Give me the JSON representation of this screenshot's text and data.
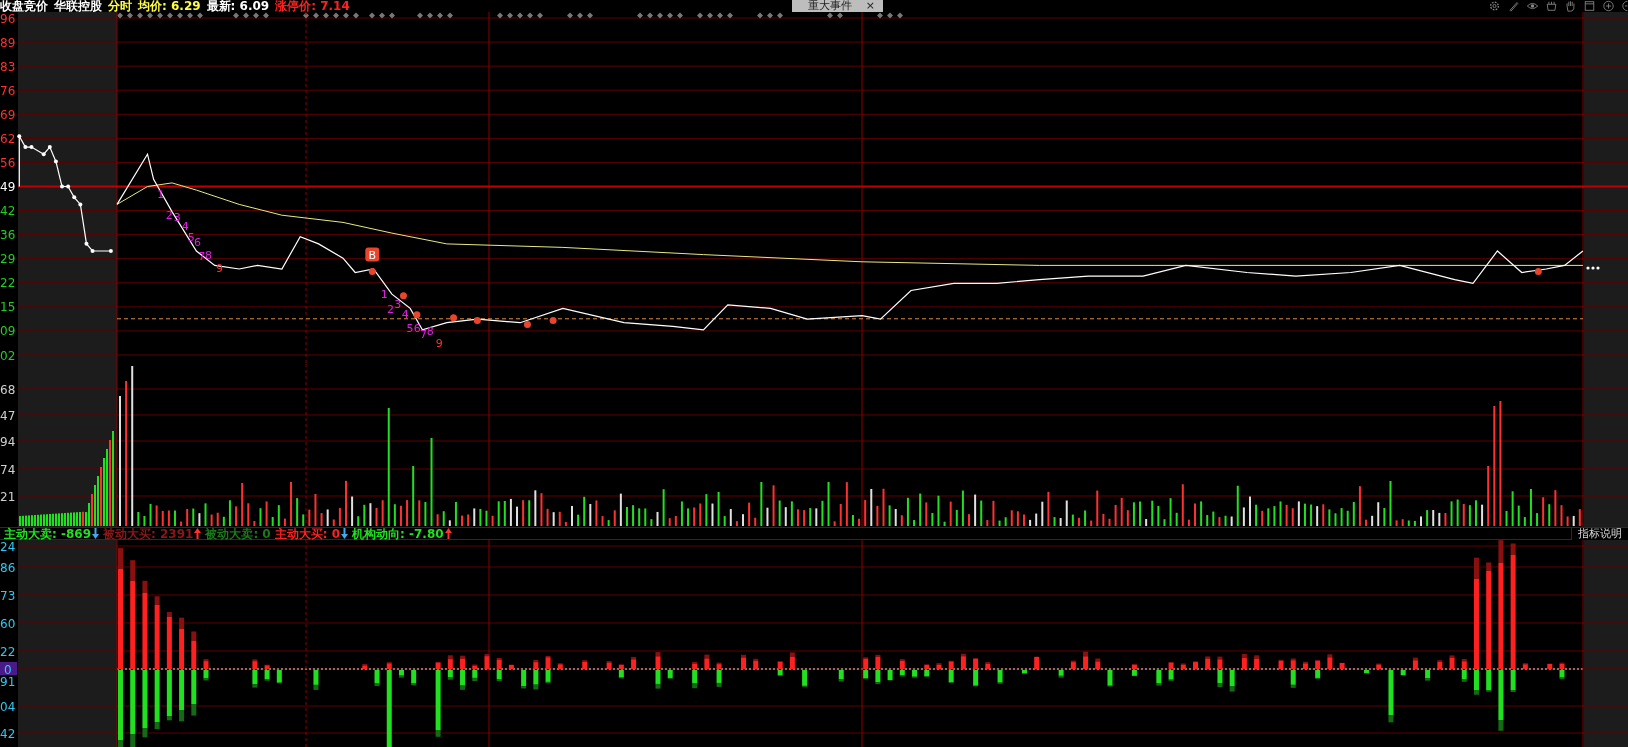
{
  "top_bar": {
    "items": [
      {
        "text": "收盘竞价",
        "color": "#ffffff"
      },
      {
        "text": "华联控股",
        "color": "#ffffff"
      },
      {
        "text": "分时",
        "color": "#ffff40"
      },
      {
        "text": "均价: 6.29",
        "color": "#ffff40"
      },
      {
        "text": "最新: 6.09",
        "color": "#ffffff"
      },
      {
        "text": "涨停价: 7.14",
        "color": "#ff2020"
      }
    ],
    "event_tab": {
      "label": "重大事件",
      "close": "×"
    }
  },
  "price_pane": {
    "ticks": [
      {
        "label": "96",
        "color": "#ff3030"
      },
      {
        "label": "89",
        "color": "#ff3030"
      },
      {
        "label": "83",
        "color": "#ff3030"
      },
      {
        "label": "76",
        "color": "#ff3030"
      },
      {
        "label": "69",
        "color": "#ff3030"
      },
      {
        "label": "62",
        "color": "#ff3030"
      },
      {
        "label": "56",
        "color": "#ff3030"
      },
      {
        "label": "49",
        "color": "#ffffff"
      },
      {
        "label": "42",
        "color": "#20d020"
      },
      {
        "label": "36",
        "color": "#20d020"
      },
      {
        "label": "29",
        "color": "#20d020"
      },
      {
        "label": "22",
        "color": "#20d020"
      },
      {
        "label": "15",
        "color": "#20d020"
      },
      {
        "label": "09",
        "color": "#20d020"
      },
      {
        "label": "02",
        "color": "#20d020"
      }
    ],
    "signals": [
      {
        "text": "1",
        "color": "#e020e0"
      },
      {
        "text": "2",
        "color": "#e020e0"
      },
      {
        "text": "3",
        "color": "#e020e0"
      },
      {
        "text": "4",
        "color": "#e020e0"
      },
      {
        "text": "5",
        "color": "#e020e0"
      },
      {
        "text": "6",
        "color": "#e020e0"
      },
      {
        "text": "7",
        "color": "#e020e0"
      },
      {
        "text": "8",
        "color": "#e020e0"
      },
      {
        "text": "9",
        "color": "#ff3030"
      },
      {
        "text": "1",
        "color": "#e020e0"
      },
      {
        "text": "2",
        "color": "#e020e0"
      },
      {
        "text": "3",
        "color": "#e020e0"
      },
      {
        "text": "4",
        "color": "#e020e0"
      },
      {
        "text": "5",
        "color": "#e020e0"
      },
      {
        "text": "6",
        "color": "#e020e0"
      },
      {
        "text": "7",
        "color": "#e020e0"
      },
      {
        "text": "8",
        "color": "#e020e0"
      },
      {
        "text": "9",
        "color": "#ff3030"
      }
    ],
    "badge": {
      "text": "B"
    }
  },
  "volume_pane": {
    "ticks": [
      "68",
      "47",
      "94",
      "74",
      "21"
    ]
  },
  "indicator_legend": {
    "items": [
      {
        "text": "主动大卖: -869",
        "color": "#20e020",
        "kind": "falling"
      },
      {
        "text": "被动大买: 2391",
        "color": "#8a1818",
        "kind": "rising"
      },
      {
        "text": "被动大卖: 0",
        "color": "#1a7a1a",
        "kind": "plain"
      },
      {
        "text": "主动大买: 0",
        "color": "#ff2020",
        "kind": "falling"
      },
      {
        "text": "机构动向: -7.80",
        "color": "#20e020",
        "kind": "rising"
      }
    ],
    "button": "指标说明"
  },
  "flow_pane": {
    "ticks": [
      "24",
      "86",
      "73",
      "60",
      "22",
      "0",
      "91",
      "04",
      "42"
    ]
  }
}
